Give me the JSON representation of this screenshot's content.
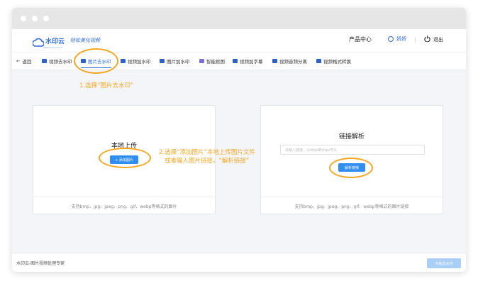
{
  "header": {
    "logo_name": "水印云",
    "logo_sub": "Watermark Cloud",
    "slogan": "轻松美化视频",
    "product_center": "产品中心",
    "user_name": "娇娇",
    "logout": "退出"
  },
  "toolbar": {
    "back": "返回",
    "items": [
      {
        "label": "视频去水印"
      },
      {
        "label": "图片去水印"
      },
      {
        "label": "视频加水印"
      },
      {
        "label": "图片加水印"
      },
      {
        "label": "智能抠图"
      },
      {
        "label": "视频加字幕"
      },
      {
        "label": "视频音频分离"
      },
      {
        "label": "视频格式转换"
      }
    ],
    "active_index": 1
  },
  "annotations": {
    "step1": "1.选择“图片去水印”",
    "step2_line1": "2.选择“添加图片”本地上传图片文件",
    "step2_line2": "或者输入图片链接，“解析链接”"
  },
  "local_upload": {
    "title": "本地上传",
    "button": "+ 添加图片",
    "footer": "支持bmp、jpg、jpeg、png、gif、webp等格式的图片"
  },
  "link_parse": {
    "title": "链接解析",
    "placeholder": "请输入链接，以http或https开头",
    "button": "解析链接",
    "footer": "支持bmp、jpg、jpeg、png、gif、webp等格式的图片链接"
  },
  "footer": {
    "brand": "水印云-图片视频处理专家",
    "start_button": "开始去水印"
  },
  "colors": {
    "accent": "#2c6ad9",
    "annotation": "#f5a623",
    "button": "#2f8ef0"
  }
}
